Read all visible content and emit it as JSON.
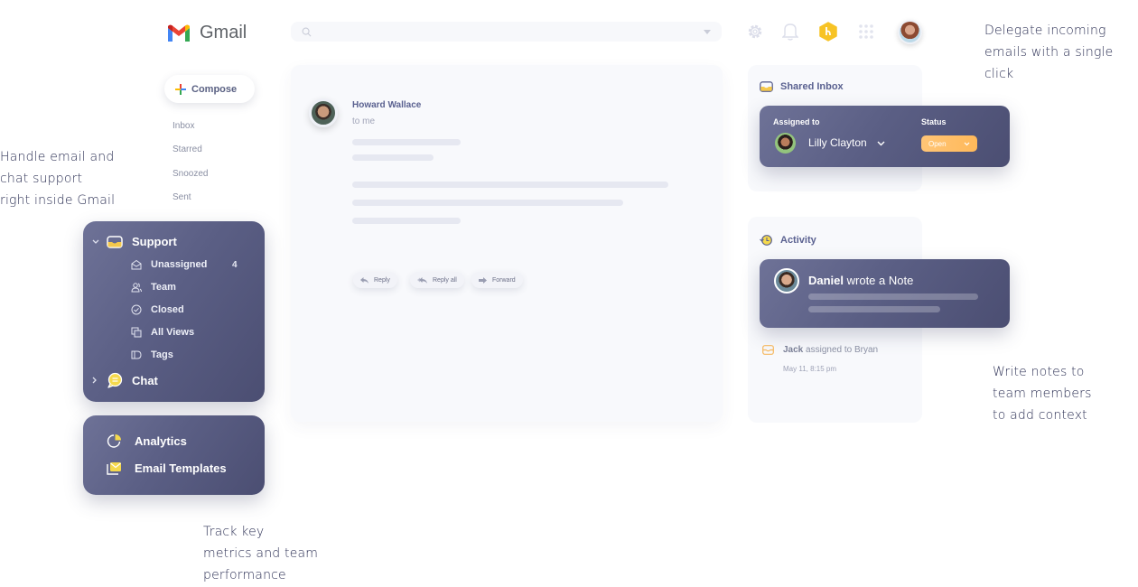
{
  "app": {
    "title": "Gmail"
  },
  "search": {
    "placeholder": ""
  },
  "topbar": {
    "icons": [
      "gear-icon",
      "bell-icon",
      "hiver-logo-icon",
      "apps-grid-icon",
      "user-avatar"
    ]
  },
  "compose": {
    "label": "Compose"
  },
  "gmail_nav": [
    {
      "label": "Inbox"
    },
    {
      "label": "Starred"
    },
    {
      "label": "Snoozed"
    },
    {
      "label": "Sent"
    }
  ],
  "support": {
    "label": "Support",
    "items": [
      {
        "label": "Unassigned",
        "count": "4",
        "icon": "envelope-open-icon"
      },
      {
        "label": "Team",
        "icon": "team-icon"
      },
      {
        "label": "Closed",
        "icon": "check-circle-icon"
      },
      {
        "label": "All Views",
        "icon": "views-icon"
      },
      {
        "label": "Tags",
        "icon": "tag-icon"
      }
    ],
    "chat_label": "Chat"
  },
  "tools": {
    "analytics_label": "Analytics",
    "templates_label": "Email Templates"
  },
  "email": {
    "sender": "Howard Wallace",
    "to": "to me",
    "actions": {
      "reply": "Reply",
      "reply_all": "Reply all",
      "forward": "Forward"
    }
  },
  "shared_inbox": {
    "title": "Shared Inbox",
    "assigned_label": "Assigned to",
    "assignee": "Lilly Clayton",
    "status_label": "Status",
    "status_value": "Open"
  },
  "activity": {
    "title": "Activity",
    "note_author": "Daniel",
    "note_action": " wrote a Note",
    "log_actor": "Jack",
    "log_action": "assigned to Bryan",
    "log_time": "May 11, 8:15 pm"
  },
  "annotations": {
    "left": [
      "Handle email and",
      "chat support",
      "right inside Gmail"
    ],
    "top_right": [
      "Delegate incoming",
      "emails with a single",
      "click"
    ],
    "bottom_right": [
      "Write notes to",
      "team members",
      "to add context"
    ],
    "bottom": [
      "Track key",
      "metrics and team",
      "performance"
    ]
  },
  "colors": {
    "accent_yellow": "#f5c84c",
    "panel_purple": "#5b5f85",
    "status_orange": "#ffbd62"
  }
}
